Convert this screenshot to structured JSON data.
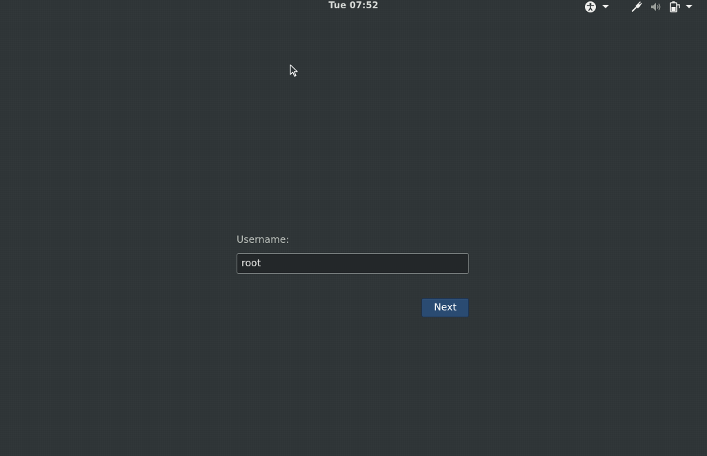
{
  "topbar": {
    "clock": "Tue 07:52",
    "icons": [
      "accessibility-icon",
      "chevron-down-icon",
      "network-icon",
      "volume-icon",
      "power-icon",
      "chevron-down-icon"
    ]
  },
  "login": {
    "username_label": "Username:",
    "username_value": "root",
    "next_label": "Next"
  },
  "colors": {
    "background": "#2e3436",
    "button": "#2a4b72",
    "field": "#232729"
  }
}
